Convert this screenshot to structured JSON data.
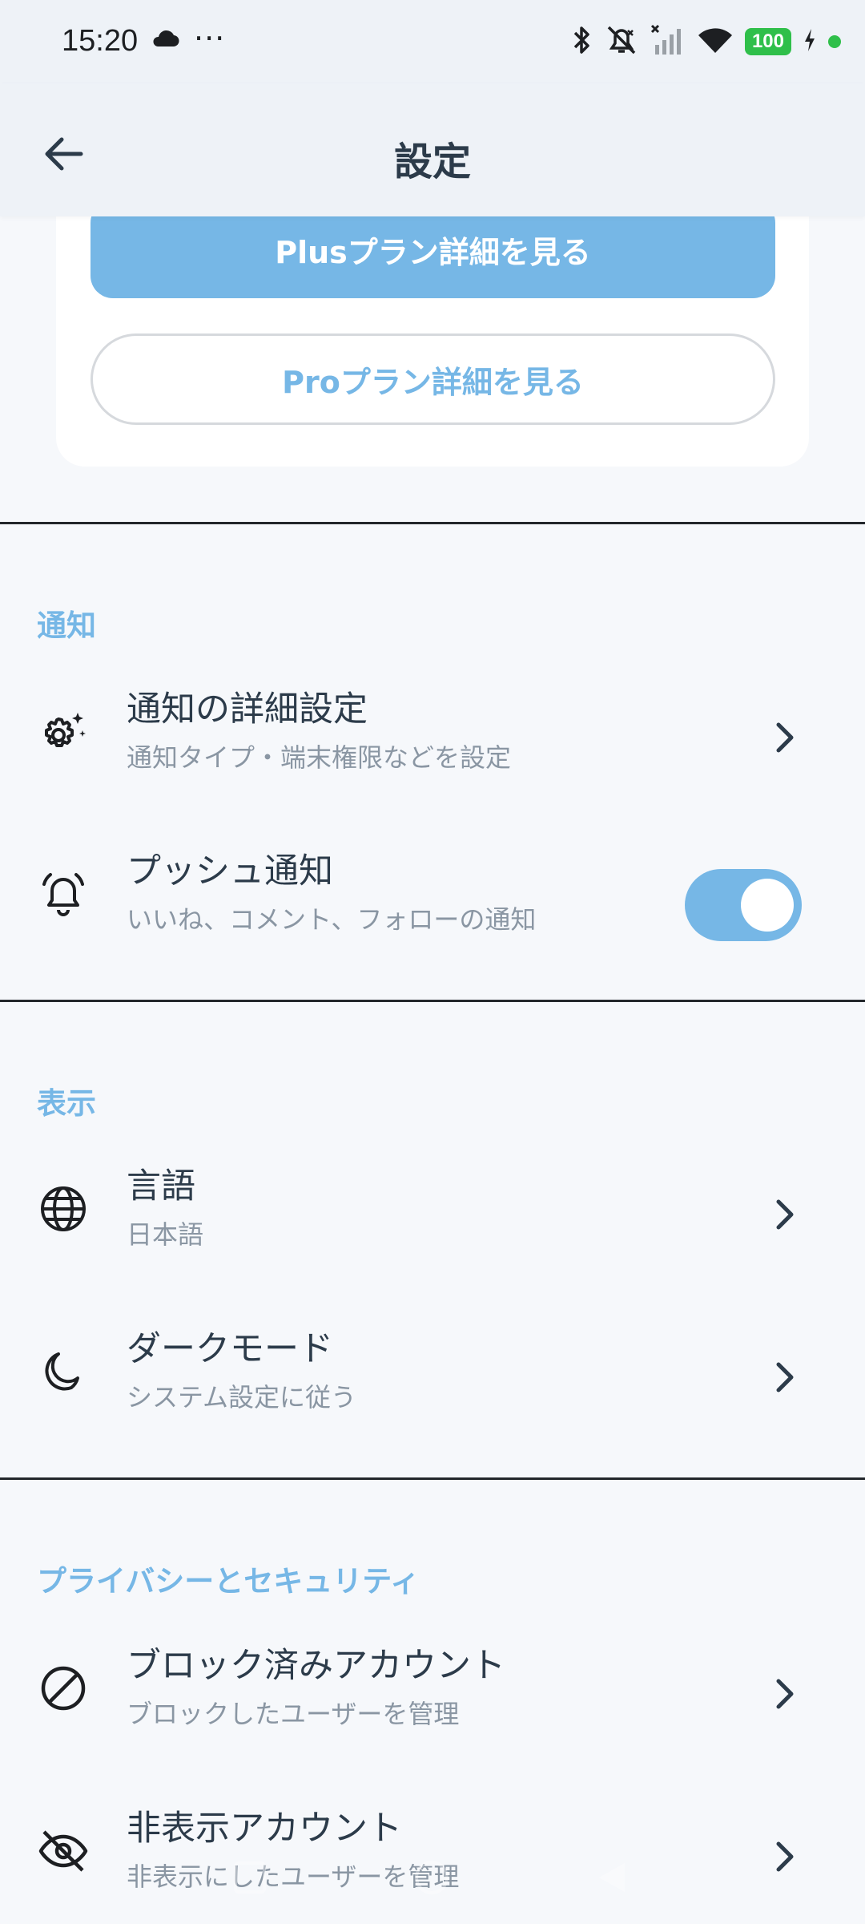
{
  "status_bar": {
    "time": "15:20",
    "overflow": "···",
    "battery": "100",
    "icons": [
      "cloud-icon",
      "bluetooth-icon",
      "mute-icon",
      "signal-off-icon",
      "wifi-icon",
      "charging-icon"
    ]
  },
  "app_bar": {
    "title": "設定",
    "back_icon": "arrow-left-icon"
  },
  "plans": {
    "plus_label": "Plusプラン詳細を見る",
    "pro_label": "Proプラン詳細を見る"
  },
  "sections": {
    "notifications": {
      "header": "通知",
      "items": [
        {
          "title": "通知の詳細設定",
          "subtitle": "通知タイプ・端末権限などを設定",
          "icon": "gear-sparkle-icon"
        },
        {
          "title": "プッシュ通知",
          "subtitle": "いいね、コメント、フォローの通知",
          "icon": "bell-ringing-icon",
          "toggle_on": true
        }
      ]
    },
    "display": {
      "header": "表示",
      "items": [
        {
          "title": "言語",
          "subtitle": "日本語",
          "icon": "globe-icon"
        },
        {
          "title": "ダークモード",
          "subtitle": "システム設定に従う",
          "icon": "moon-icon"
        }
      ]
    },
    "privacy": {
      "header": "プライバシーとセキュリティ",
      "items": [
        {
          "title": "ブロック済みアカウント",
          "subtitle": "ブロックしたユーザーを管理",
          "icon": "block-icon"
        },
        {
          "title": "非表示アカウント",
          "subtitle": "非表示にしたユーザーを管理",
          "icon": "eye-off-icon"
        }
      ]
    }
  },
  "colors": {
    "accent": "#76b7e6",
    "background": "#f6f8fb",
    "text": "#2c3b4a",
    "subtext": "#8a96a3"
  }
}
